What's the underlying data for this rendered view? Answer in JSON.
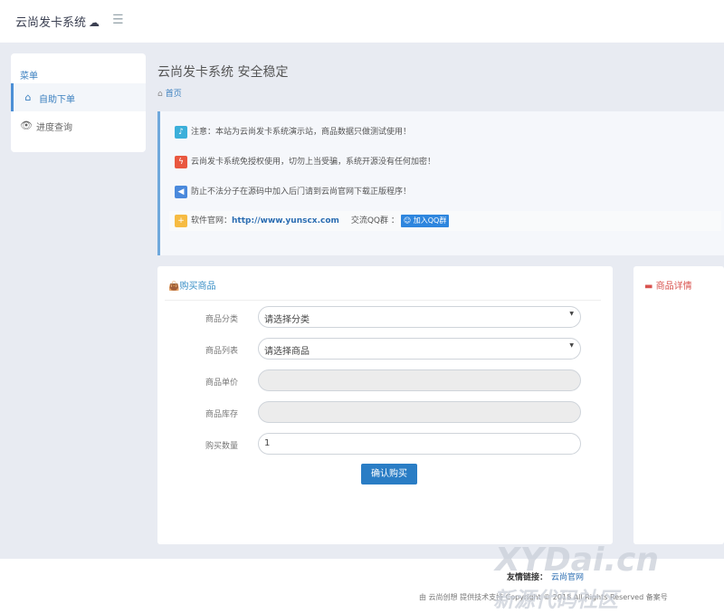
{
  "header": {
    "brand": "云尚发卡系统",
    "cloud_icon": "cloud-icon",
    "menu_icon": "list-icon"
  },
  "sidebar": {
    "title": "菜单",
    "items": [
      {
        "label": "自助下单",
        "icon": "home-icon",
        "active": true
      },
      {
        "label": "进度查询",
        "icon": "eye-icon",
        "active": false
      }
    ]
  },
  "page": {
    "title": "云尚发卡系统 安全稳定",
    "breadcrumb": "首页"
  },
  "notices": [
    {
      "icon": "bell-icon",
      "color": "#3bafda",
      "text": "注意：本站为云尚发卡系统演示站，商品数据只做测试使用！"
    },
    {
      "icon": "bolt-icon",
      "color": "#e9573f",
      "text": "云尚发卡系统免授权使用，切勿上当受骗，系统开源没有任何加密！"
    },
    {
      "icon": "bullhorn-icon",
      "color": "#4a89dc",
      "text": "防止不法分子在源码中加入后门请到云尚官网下载正版程序！"
    }
  ],
  "site_info": {
    "label": "软件官网：",
    "url": "http://www.yunscx.com",
    "qq_label": "交流QQ群 ：",
    "qq_button": "加入QQ群",
    "icon_color": "#f6bb42"
  },
  "buy": {
    "title": "购买商品",
    "fields": [
      {
        "label": "商品分类",
        "value": "请选择分类",
        "type": "select"
      },
      {
        "label": "商品列表",
        "value": "请选择商品",
        "type": "select"
      },
      {
        "label": "商品单价",
        "value": "",
        "type": "readonly"
      },
      {
        "label": "商品库存",
        "value": "",
        "type": "readonly"
      },
      {
        "label": "购买数量",
        "value": "1",
        "type": "input"
      }
    ],
    "submit": "确认购买"
  },
  "detail": {
    "title": "商品详情"
  },
  "footer": {
    "links_label": "友情链接：",
    "link": "云尚官网",
    "copyright": "由 云尚创想 提供技术支持 Copyright © 2018 All Rights Reserved 备案号"
  },
  "watermark": {
    "line1": "XYDai.cn",
    "line2": "新源代码社区"
  },
  "colors": {
    "accent": "#2a7dc5",
    "background": "#e8ebf2"
  }
}
